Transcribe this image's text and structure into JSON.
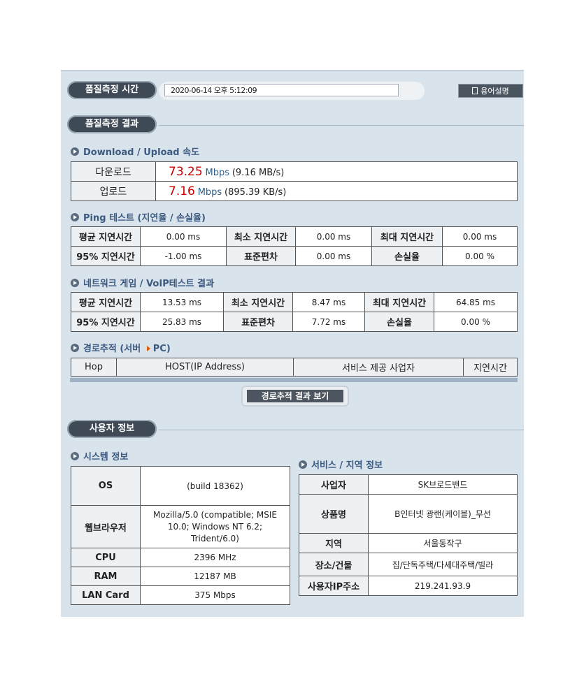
{
  "measure": {
    "time_label": "품질측정 시간",
    "time_value": "2020-06-14 오후 5:12:09",
    "glossary_button": "용어설명",
    "result_label": "품질측정 결과"
  },
  "speed": {
    "section_title": "Download / Upload 속도",
    "rows": [
      {
        "label": "다운로드",
        "value": "73.25",
        "unit": "Mbps",
        "extra": "(9.16 MB/s)"
      },
      {
        "label": "업로드",
        "value": "7.16",
        "unit": "Mbps",
        "extra": "(895.39 KB/s)"
      }
    ]
  },
  "ping": {
    "section_title": "Ping 테스트 (지연율 / 손실율)",
    "rows": [
      [
        "평균 지연시간",
        "0.00 ms",
        "최소 지연시간",
        "0.00 ms",
        "최대 지연시간",
        "0.00 ms"
      ],
      [
        "95% 지연시간",
        "-1.00 ms",
        "표준편차",
        "0.00 ms",
        "손실율",
        "0.00 %"
      ]
    ]
  },
  "voip": {
    "section_title": "네트워크 게임 / VoIP테스트 결과",
    "rows": [
      [
        "평균 지연시간",
        "13.53 ms",
        "최소 지연시간",
        "8.47 ms",
        "최대 지연시간",
        "64.85 ms"
      ],
      [
        "95% 지연시간",
        "25.83 ms",
        "표준편차",
        "7.72 ms",
        "손실율",
        "0.00 %"
      ]
    ]
  },
  "trace": {
    "section_title_a": "경로추적 (서버",
    "section_title_b": "PC)",
    "headers": [
      "Hop",
      "HOST(IP Address)",
      "서비스 제공 사업자",
      "지연시간"
    ],
    "button": "경로추적 결과 보기"
  },
  "user": {
    "title": "사용자 정보",
    "system_title": "시스템 정보",
    "system_rows": [
      {
        "label": "OS",
        "value": "(build 18362)"
      },
      {
        "label": "웹브라우저",
        "value": "Mozilla/5.0 (compatible; MSIE 10.0; Windows NT 6.2; Trident/6.0)"
      },
      {
        "label": "CPU",
        "value": "2396 MHz"
      },
      {
        "label": "RAM",
        "value": "12187 MB"
      },
      {
        "label": "LAN Card",
        "value": "375 Mbps"
      }
    ],
    "service_title": "서비스 / 지역 정보",
    "service_rows": [
      {
        "label": "사업자",
        "value": "SK브로드밴드"
      },
      {
        "label": "상품명",
        "value": "B인터넷 광랜(케이블)_무선"
      },
      {
        "label": "지역",
        "value": "서울동작구"
      },
      {
        "label": "장소/건물",
        "value": "집/단독주택/다세대주택/빌라"
      },
      {
        "label": "사용자IP주소",
        "value": "219.241.93.9"
      }
    ]
  },
  "colors": {
    "accent": "#c00000",
    "link": "#3c5a80",
    "panel": "#d9e3ec"
  }
}
